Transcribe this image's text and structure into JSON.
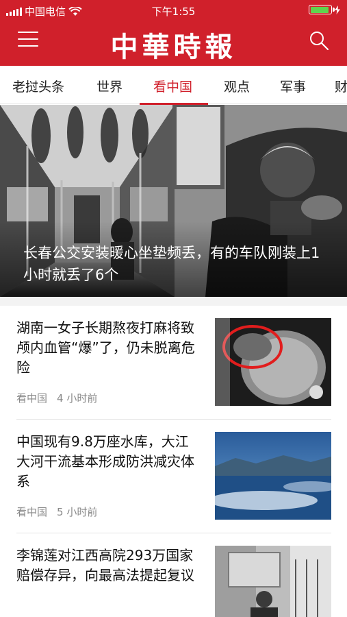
{
  "status_bar": {
    "carrier": "中国电信",
    "time": "下午1:55",
    "battery_level": 0.9,
    "battery_color": "#5fd34d"
  },
  "header": {
    "title": "中華時報",
    "menu_icon": "hamburger-menu-icon",
    "search_icon": "search-icon",
    "background_color": "#d0202b"
  },
  "tabs": [
    {
      "label": "老挝头条",
      "active": false
    },
    {
      "label": "世界",
      "active": false
    },
    {
      "label": "看中国",
      "active": true
    },
    {
      "label": "观点",
      "active": false
    },
    {
      "label": "军事",
      "active": false
    },
    {
      "label": "财",
      "active": false
    }
  ],
  "hero": {
    "caption": "长春公交安装暖心坐垫频丢，有的车队刚装上1小时就丢了6个"
  },
  "news": [
    {
      "title": "湖南一女子长期熬夜打麻将致颅内血管“爆”了，仍未脱离危险",
      "category": "看中国",
      "time": "4 小时前"
    },
    {
      "title": "中国现有9.8万座水库，大江大河干流基本形成防洪减灾体系",
      "category": "看中国",
      "time": "5 小时前"
    },
    {
      "title": "李锦莲对江西高院293万国家赔偿存异，向最高法提起复议",
      "category": "",
      "time": ""
    }
  ]
}
